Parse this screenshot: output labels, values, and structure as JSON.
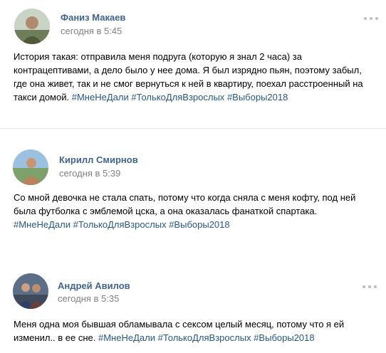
{
  "posts": [
    {
      "author": "Фаниз Макаев",
      "time": "сегодня в 5:45",
      "text": "История такая: отправила меня подруга (которую я знал 2 часа) за контрацептивами, а дело было у нее дома. Я был изрядно пьян, поэтому забыл, где она живет, так и не смог вернуться к ней в квартиру, поехал расстроенный на такси домой.",
      "hashtags": [
        "#МнеНеДали",
        "#ТолькоДляВзрослых",
        "#Выборы2018"
      ]
    },
    {
      "author": "Кирилл Смирнов",
      "time": "сегодня в 5:39",
      "text": "Со мной девочка не стала спать, потому что когда сняла с меня кофту, под ней была футболка с эмблемой цска, а она оказалась фанаткой спартака.",
      "hashtags": [
        "#МнеНеДали",
        "#ТолькоДляВзрослых",
        "#Выборы2018"
      ]
    },
    {
      "author": "Андрей Авилов",
      "time": "сегодня в 5:35",
      "text": "Меня одна моя бывшая обламывала с сексом целый месяц, потому что я ей изменил.. в ее сне.",
      "hashtags": [
        "#МнеНеДали",
        "#ТолькоДляВзрослых",
        "#Выборы2018"
      ]
    }
  ],
  "icons": {
    "more": "more-dots-icon"
  },
  "colors": {
    "author": "#42648b",
    "time": "#828282",
    "hashtag": "#2a5885",
    "divider": "#e7e8ec"
  }
}
